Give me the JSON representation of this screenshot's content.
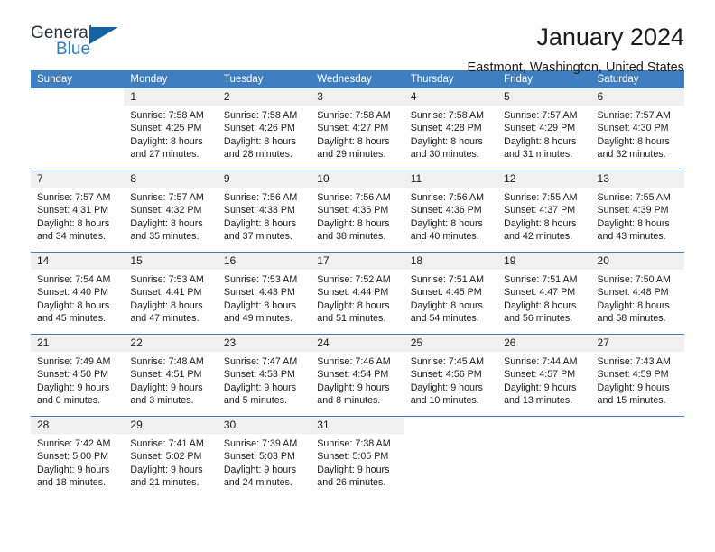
{
  "brand": {
    "name_top": "General",
    "name_bottom": "Blue",
    "accent_color": "#2e7fc1",
    "triangle_color": "#1464a5"
  },
  "header": {
    "title": "January 2024",
    "subtitle": "Eastmont, Washington, United States"
  },
  "theme": {
    "header_blue": "#3f7fc1",
    "daynum_bg": "#f0f0f0",
    "text": "#1b1b1b"
  },
  "weekdays": [
    "Sunday",
    "Monday",
    "Tuesday",
    "Wednesday",
    "Thursday",
    "Friday",
    "Saturday"
  ],
  "weeks": [
    [
      {
        "day": "",
        "sunrise": "",
        "sunset": "",
        "daylight1": "",
        "daylight2": ""
      },
      {
        "day": "1",
        "sunrise": "Sunrise: 7:58 AM",
        "sunset": "Sunset: 4:25 PM",
        "daylight1": "Daylight: 8 hours",
        "daylight2": "and 27 minutes."
      },
      {
        "day": "2",
        "sunrise": "Sunrise: 7:58 AM",
        "sunset": "Sunset: 4:26 PM",
        "daylight1": "Daylight: 8 hours",
        "daylight2": "and 28 minutes."
      },
      {
        "day": "3",
        "sunrise": "Sunrise: 7:58 AM",
        "sunset": "Sunset: 4:27 PM",
        "daylight1": "Daylight: 8 hours",
        "daylight2": "and 29 minutes."
      },
      {
        "day": "4",
        "sunrise": "Sunrise: 7:58 AM",
        "sunset": "Sunset: 4:28 PM",
        "daylight1": "Daylight: 8 hours",
        "daylight2": "and 30 minutes."
      },
      {
        "day": "5",
        "sunrise": "Sunrise: 7:57 AM",
        "sunset": "Sunset: 4:29 PM",
        "daylight1": "Daylight: 8 hours",
        "daylight2": "and 31 minutes."
      },
      {
        "day": "6",
        "sunrise": "Sunrise: 7:57 AM",
        "sunset": "Sunset: 4:30 PM",
        "daylight1": "Daylight: 8 hours",
        "daylight2": "and 32 minutes."
      }
    ],
    [
      {
        "day": "7",
        "sunrise": "Sunrise: 7:57 AM",
        "sunset": "Sunset: 4:31 PM",
        "daylight1": "Daylight: 8 hours",
        "daylight2": "and 34 minutes."
      },
      {
        "day": "8",
        "sunrise": "Sunrise: 7:57 AM",
        "sunset": "Sunset: 4:32 PM",
        "daylight1": "Daylight: 8 hours",
        "daylight2": "and 35 minutes."
      },
      {
        "day": "9",
        "sunrise": "Sunrise: 7:56 AM",
        "sunset": "Sunset: 4:33 PM",
        "daylight1": "Daylight: 8 hours",
        "daylight2": "and 37 minutes."
      },
      {
        "day": "10",
        "sunrise": "Sunrise: 7:56 AM",
        "sunset": "Sunset: 4:35 PM",
        "daylight1": "Daylight: 8 hours",
        "daylight2": "and 38 minutes."
      },
      {
        "day": "11",
        "sunrise": "Sunrise: 7:56 AM",
        "sunset": "Sunset: 4:36 PM",
        "daylight1": "Daylight: 8 hours",
        "daylight2": "and 40 minutes."
      },
      {
        "day": "12",
        "sunrise": "Sunrise: 7:55 AM",
        "sunset": "Sunset: 4:37 PM",
        "daylight1": "Daylight: 8 hours",
        "daylight2": "and 42 minutes."
      },
      {
        "day": "13",
        "sunrise": "Sunrise: 7:55 AM",
        "sunset": "Sunset: 4:39 PM",
        "daylight1": "Daylight: 8 hours",
        "daylight2": "and 43 minutes."
      }
    ],
    [
      {
        "day": "14",
        "sunrise": "Sunrise: 7:54 AM",
        "sunset": "Sunset: 4:40 PM",
        "daylight1": "Daylight: 8 hours",
        "daylight2": "and 45 minutes."
      },
      {
        "day": "15",
        "sunrise": "Sunrise: 7:53 AM",
        "sunset": "Sunset: 4:41 PM",
        "daylight1": "Daylight: 8 hours",
        "daylight2": "and 47 minutes."
      },
      {
        "day": "16",
        "sunrise": "Sunrise: 7:53 AM",
        "sunset": "Sunset: 4:43 PM",
        "daylight1": "Daylight: 8 hours",
        "daylight2": "and 49 minutes."
      },
      {
        "day": "17",
        "sunrise": "Sunrise: 7:52 AM",
        "sunset": "Sunset: 4:44 PM",
        "daylight1": "Daylight: 8 hours",
        "daylight2": "and 51 minutes."
      },
      {
        "day": "18",
        "sunrise": "Sunrise: 7:51 AM",
        "sunset": "Sunset: 4:45 PM",
        "daylight1": "Daylight: 8 hours",
        "daylight2": "and 54 minutes."
      },
      {
        "day": "19",
        "sunrise": "Sunrise: 7:51 AM",
        "sunset": "Sunset: 4:47 PM",
        "daylight1": "Daylight: 8 hours",
        "daylight2": "and 56 minutes."
      },
      {
        "day": "20",
        "sunrise": "Sunrise: 7:50 AM",
        "sunset": "Sunset: 4:48 PM",
        "daylight1": "Daylight: 8 hours",
        "daylight2": "and 58 minutes."
      }
    ],
    [
      {
        "day": "21",
        "sunrise": "Sunrise: 7:49 AM",
        "sunset": "Sunset: 4:50 PM",
        "daylight1": "Daylight: 9 hours",
        "daylight2": "and 0 minutes."
      },
      {
        "day": "22",
        "sunrise": "Sunrise: 7:48 AM",
        "sunset": "Sunset: 4:51 PM",
        "daylight1": "Daylight: 9 hours",
        "daylight2": "and 3 minutes."
      },
      {
        "day": "23",
        "sunrise": "Sunrise: 7:47 AM",
        "sunset": "Sunset: 4:53 PM",
        "daylight1": "Daylight: 9 hours",
        "daylight2": "and 5 minutes."
      },
      {
        "day": "24",
        "sunrise": "Sunrise: 7:46 AM",
        "sunset": "Sunset: 4:54 PM",
        "daylight1": "Daylight: 9 hours",
        "daylight2": "and 8 minutes."
      },
      {
        "day": "25",
        "sunrise": "Sunrise: 7:45 AM",
        "sunset": "Sunset: 4:56 PM",
        "daylight1": "Daylight: 9 hours",
        "daylight2": "and 10 minutes."
      },
      {
        "day": "26",
        "sunrise": "Sunrise: 7:44 AM",
        "sunset": "Sunset: 4:57 PM",
        "daylight1": "Daylight: 9 hours",
        "daylight2": "and 13 minutes."
      },
      {
        "day": "27",
        "sunrise": "Sunrise: 7:43 AM",
        "sunset": "Sunset: 4:59 PM",
        "daylight1": "Daylight: 9 hours",
        "daylight2": "and 15 minutes."
      }
    ],
    [
      {
        "day": "28",
        "sunrise": "Sunrise: 7:42 AM",
        "sunset": "Sunset: 5:00 PM",
        "daylight1": "Daylight: 9 hours",
        "daylight2": "and 18 minutes."
      },
      {
        "day": "29",
        "sunrise": "Sunrise: 7:41 AM",
        "sunset": "Sunset: 5:02 PM",
        "daylight1": "Daylight: 9 hours",
        "daylight2": "and 21 minutes."
      },
      {
        "day": "30",
        "sunrise": "Sunrise: 7:39 AM",
        "sunset": "Sunset: 5:03 PM",
        "daylight1": "Daylight: 9 hours",
        "daylight2": "and 24 minutes."
      },
      {
        "day": "31",
        "sunrise": "Sunrise: 7:38 AM",
        "sunset": "Sunset: 5:05 PM",
        "daylight1": "Daylight: 9 hours",
        "daylight2": "and 26 minutes."
      },
      {
        "day": "",
        "sunrise": "",
        "sunset": "",
        "daylight1": "",
        "daylight2": ""
      },
      {
        "day": "",
        "sunrise": "",
        "sunset": "",
        "daylight1": "",
        "daylight2": ""
      },
      {
        "day": "",
        "sunrise": "",
        "sunset": "",
        "daylight1": "",
        "daylight2": ""
      }
    ]
  ]
}
